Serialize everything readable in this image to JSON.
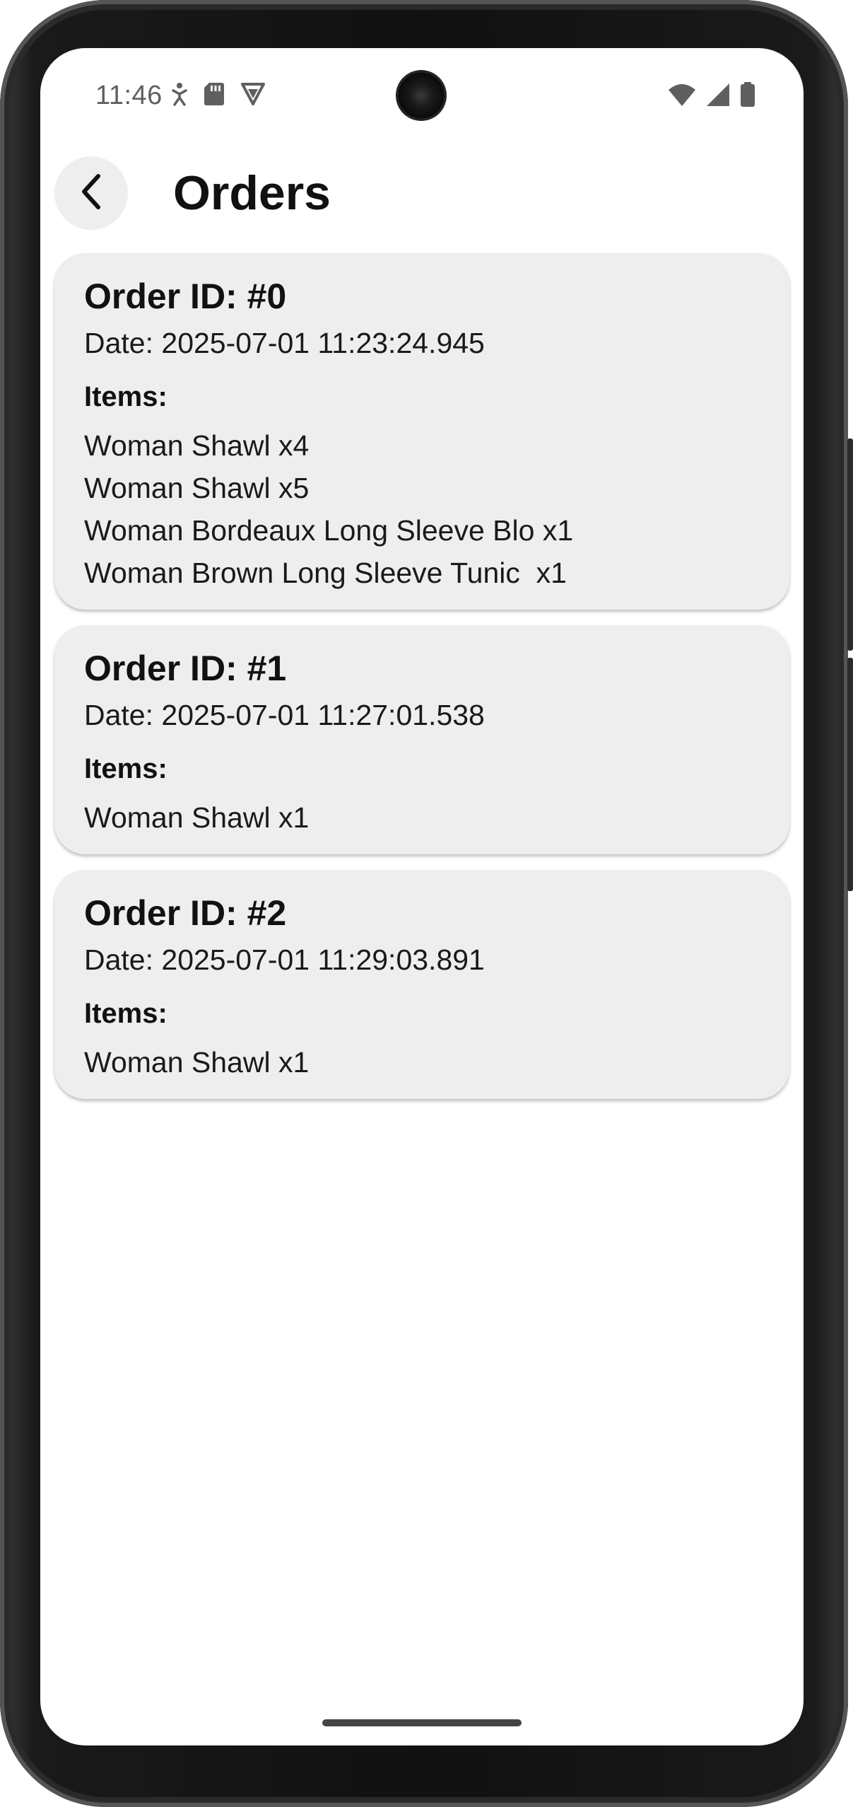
{
  "status_bar": {
    "time": "11:46",
    "left_icons": [
      "accessibility-icon",
      "sd-card-icon",
      "vpn-shield-icon"
    ],
    "right_icons": [
      "wifi-icon",
      "cell-signal-icon",
      "battery-icon"
    ]
  },
  "app_bar": {
    "back_icon": "chevron-left-icon",
    "title": "Orders"
  },
  "orders": [
    {
      "id_label": "Order ID: #0",
      "date_label": "Date: 2025-07-01 11:23:24.945",
      "items_label": "Items:",
      "items": [
        "Woman Shawl x4",
        "Woman Shawl x5",
        "Woman Bordeaux Long Sleeve Blo x1",
        "Woman Brown Long Sleeve Tunic  x1"
      ]
    },
    {
      "id_label": "Order ID: #1",
      "date_label": "Date: 2025-07-01 11:27:01.538",
      "items_label": "Items:",
      "items": [
        "Woman Shawl x1"
      ]
    },
    {
      "id_label": "Order ID: #2",
      "date_label": "Date: 2025-07-01 11:29:03.891",
      "items_label": "Items:",
      "items": [
        "Woman Shawl x1"
      ]
    }
  ],
  "colors": {
    "card_background": "#eeeeee",
    "text": "#111111",
    "status_text": "#5f5f5f"
  }
}
